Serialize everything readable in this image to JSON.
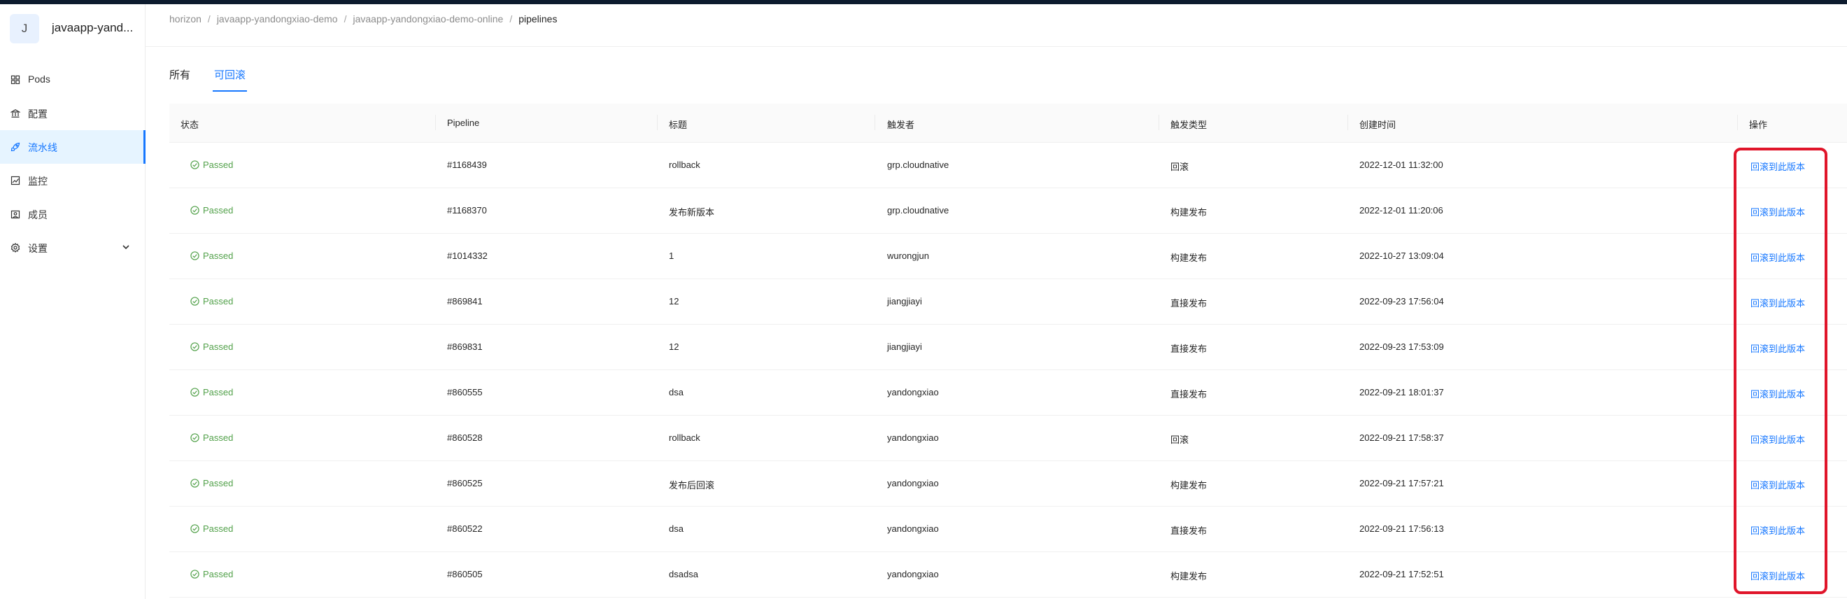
{
  "app": {
    "avatar_letter": "J",
    "name": "javaapp-yand..."
  },
  "sidebar": {
    "items": [
      {
        "label": "Pods",
        "icon": "grid-icon",
        "active": false
      },
      {
        "label": "配置",
        "icon": "bank-icon",
        "active": false
      },
      {
        "label": "流水线",
        "icon": "rocket-icon",
        "active": true
      },
      {
        "label": "监控",
        "icon": "chart-icon",
        "active": false
      },
      {
        "label": "成员",
        "icon": "team-icon",
        "active": false
      },
      {
        "label": "设置",
        "icon": "gear-icon",
        "active": false,
        "expandable": true
      }
    ]
  },
  "breadcrumb": {
    "items": [
      "horizon",
      "javaapp-yandongxiao-demo",
      "javaapp-yandongxiao-demo-online",
      "pipelines"
    ],
    "separator": "/"
  },
  "tabs": {
    "all": "所有",
    "rollbackable": "可回滚",
    "active": "rollbackable"
  },
  "table": {
    "columns": [
      "状态",
      "Pipeline",
      "标题",
      "触发者",
      "触发类型",
      "创建时间",
      "操作"
    ],
    "rows": [
      {
        "status": "Passed",
        "pipeline": "#1168439",
        "title": "rollback",
        "trigger_by": "grp.cloudnative",
        "trigger_type": "回滚",
        "created_at": "2022-12-01 11:32:00",
        "action": "回滚到此版本"
      },
      {
        "status": "Passed",
        "pipeline": "#1168370",
        "title": "发布新版本",
        "trigger_by": "grp.cloudnative",
        "trigger_type": "构建发布",
        "created_at": "2022-12-01 11:20:06",
        "action": "回滚到此版本"
      },
      {
        "status": "Passed",
        "pipeline": "#1014332",
        "title": "1",
        "trigger_by": "wurongjun",
        "trigger_type": "构建发布",
        "created_at": "2022-10-27 13:09:04",
        "action": "回滚到此版本"
      },
      {
        "status": "Passed",
        "pipeline": "#869841",
        "title": "12",
        "trigger_by": "jiangjiayi",
        "trigger_type": "直接发布",
        "created_at": "2022-09-23 17:56:04",
        "action": "回滚到此版本"
      },
      {
        "status": "Passed",
        "pipeline": "#869831",
        "title": "12",
        "trigger_by": "jiangjiayi",
        "trigger_type": "直接发布",
        "created_at": "2022-09-23 17:53:09",
        "action": "回滚到此版本"
      },
      {
        "status": "Passed",
        "pipeline": "#860555",
        "title": "dsa",
        "trigger_by": "yandongxiao",
        "trigger_type": "直接发布",
        "created_at": "2022-09-21 18:01:37",
        "action": "回滚到此版本"
      },
      {
        "status": "Passed",
        "pipeline": "#860528",
        "title": "rollback",
        "trigger_by": "yandongxiao",
        "trigger_type": "回滚",
        "created_at": "2022-09-21 17:58:37",
        "action": "回滚到此版本"
      },
      {
        "status": "Passed",
        "pipeline": "#860525",
        "title": "发布后回滚",
        "trigger_by": "yandongxiao",
        "trigger_type": "构建发布",
        "created_at": "2022-09-21 17:57:21",
        "action": "回滚到此版本"
      },
      {
        "status": "Passed",
        "pipeline": "#860522",
        "title": "dsa",
        "trigger_by": "yandongxiao",
        "trigger_type": "直接发布",
        "created_at": "2022-09-21 17:56:13",
        "action": "回滚到此版本"
      },
      {
        "status": "Passed",
        "pipeline": "#860505",
        "title": "dsadsa",
        "trigger_by": "yandongxiao",
        "trigger_type": "构建发布",
        "created_at": "2022-09-21 17:52:51",
        "action": "回滚到此版本"
      }
    ]
  },
  "colors": {
    "accent": "#1677ff",
    "status_passed": "#52a14a",
    "highlight": "#e0152a",
    "topbar": "#0d1b2e"
  }
}
